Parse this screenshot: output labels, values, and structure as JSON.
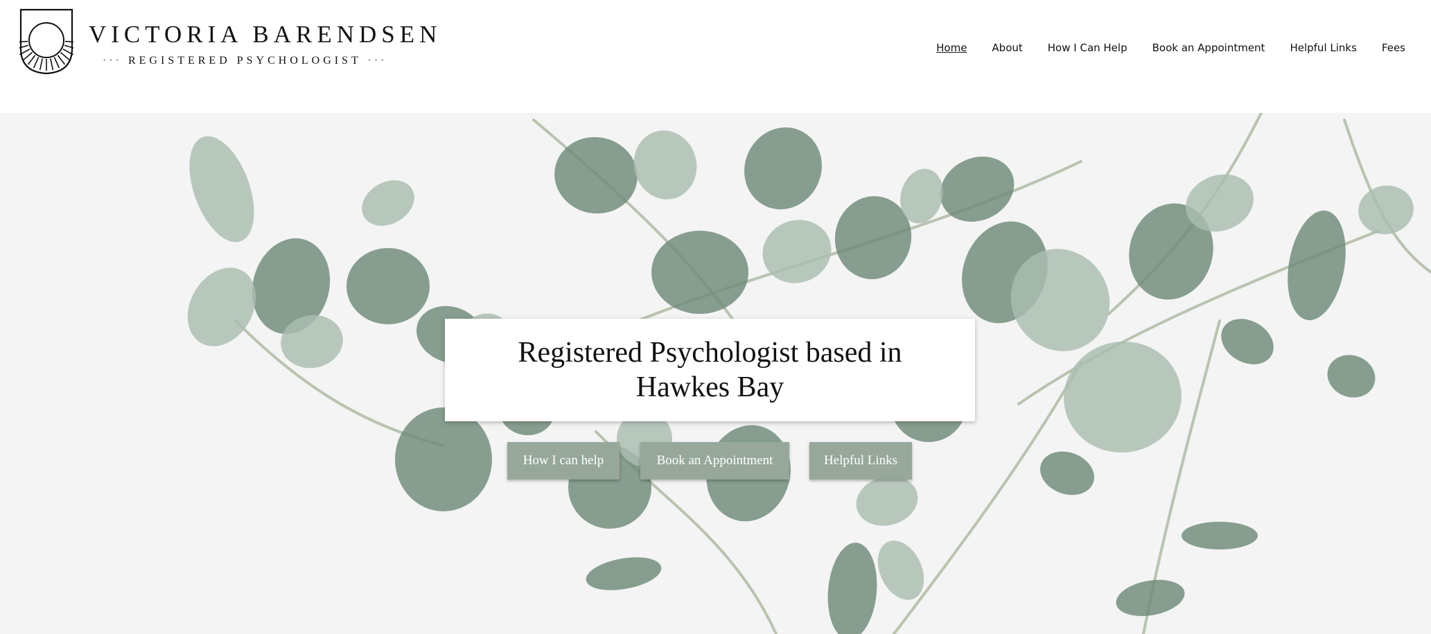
{
  "brand": {
    "name": "VICTORIA BARENDSEN",
    "subtitle": "REGISTERED PSYCHOLOGIST",
    "subtitle_dots": "···"
  },
  "nav": {
    "items": [
      {
        "label": "Home",
        "active": true
      },
      {
        "label": "About"
      },
      {
        "label": "How I Can Help"
      },
      {
        "label": "Book an Appointment"
      },
      {
        "label": "Helpful Links"
      },
      {
        "label": "Fees"
      }
    ]
  },
  "hero": {
    "title": "Registered Psychologist based in Hawkes Bay",
    "buttons": [
      {
        "label": "How I can help"
      },
      {
        "label": "Book an Appointment"
      },
      {
        "label": "Helpful Links"
      }
    ],
    "background": "eucalyptus-branches-image"
  },
  "colors": {
    "button_bg": "#97a89b",
    "leaf_dark": "#6f8a79",
    "leaf_light": "#a9bdb0",
    "hero_bg": "#f3f4f3"
  }
}
